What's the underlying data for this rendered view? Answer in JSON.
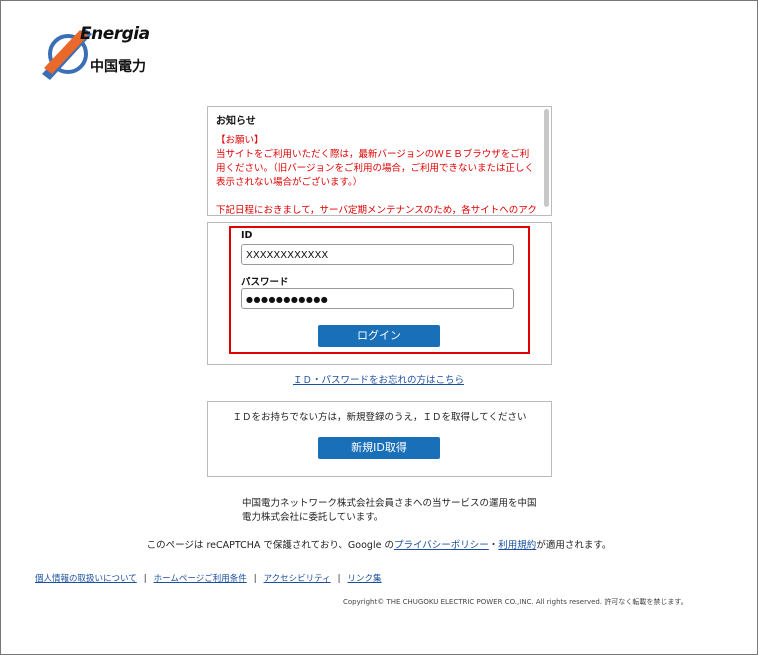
{
  "brand": {
    "logo_word": "Energia",
    "logo_jp": "中国電力",
    "colors": {
      "blue": "#3a6fb6",
      "orange": "#e8692a",
      "red": "#e00000",
      "button": "#1a6fb9"
    }
  },
  "notice": {
    "title": "お知らせ",
    "body": "【お願い】\n当サイトをご利用いただく際は，最新バージョンのＷＥＢブラウザをご利用ください。（旧バージョンをご利用の場合，ご利用できないまたは正しく表示されない場合がございます。）\n\n下記日程におきまして，サーバ定期メンテナンスのため，各サイトへのアクセスができません。ご迷惑をおかけしますが，何卒ご了承ください。"
  },
  "login": {
    "id_label": "ID",
    "id_value": "XXXXXXXXXXXX",
    "password_label": "パスワード",
    "password_value": "●●●●●●●●●●●",
    "login_button": "ログイン"
  },
  "forgot_link": "ＩＤ・パスワードをお忘れの方はこちら",
  "register": {
    "text": "ＩＤをお持ちでない方は，新規登録のうえ，ＩＤを取得してください",
    "button": "新規ID取得"
  },
  "notes": {
    "consignment": "中国電力ネットワーク株式会社会員さまへの当サービスの運用を中国\n電力株式会社に委託しています。",
    "recaptcha_prefix": "このページは reCAPTCHA で保護されており、Google の",
    "privacy_link": "プライバシーポリシー",
    "middot": "・",
    "terms_link": "利用規約",
    "recaptcha_suffix": "が適用されます。"
  },
  "footer": {
    "links": [
      "個人情報の取扱いについて",
      "ホームページご利用条件",
      "アクセシビリティ",
      "リンク集"
    ],
    "separator": "|",
    "copyright": "Copyright© THE CHUGOKU ELECTRIC POWER CO.,INC. All rights reserved. 許可なく転載を禁じます。"
  }
}
